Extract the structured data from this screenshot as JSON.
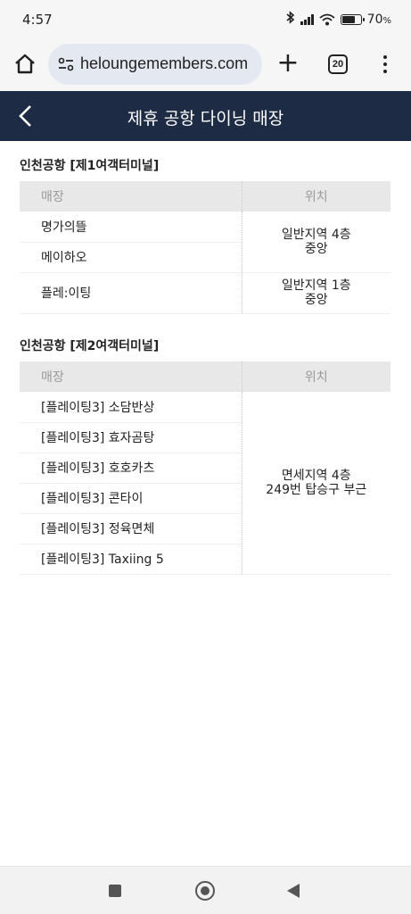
{
  "status_bar": {
    "time": "4:57",
    "battery_percent": "70",
    "battery_unit": "%",
    "battery_level": 0.7,
    "icons": [
      "bluetooth-icon",
      "signal-icon",
      "wifi-icon",
      "battery-icon"
    ]
  },
  "browser": {
    "url": "heloungemembers.com",
    "tab_count": "20",
    "icons": [
      "home-icon",
      "tune-icon",
      "plus-icon",
      "tabs-icon",
      "more-vert-icon"
    ]
  },
  "header": {
    "title": "제휴 공항 다이닝 매장",
    "background": "#1e2b45"
  },
  "sections": [
    {
      "title": "인천공항 [제1여객터미널]",
      "col_store": "매장",
      "col_location": "위치",
      "rows": [
        {
          "store": "명가의뜰",
          "location": [
            "일반지역 4층",
            "중앙"
          ]
        },
        {
          "store": "메이하오"
        },
        {
          "store": "플레:이팅",
          "location": [
            "일반지역 1층",
            "중앙"
          ]
        }
      ]
    },
    {
      "title": "인천공항 [제2여객터미널]",
      "col_store": "매장",
      "col_location": "위치",
      "rows": [
        {
          "store": "[플레이팅3] 소담반상",
          "location": [
            "면세지역 4층",
            "249번 탑승구 부근"
          ]
        },
        {
          "store": "[플레이팅3] 효자곰탕"
        },
        {
          "store": "[플레이팅3] 호호카츠"
        },
        {
          "store": "[플레이팅3] 콘타이"
        },
        {
          "store": "[플레이팅3] 정육면체"
        },
        {
          "store": "[플레이팅3] Taxiing 5"
        }
      ]
    }
  ],
  "nav_bar": {
    "icons": [
      "recents-icon",
      "home-circle-icon",
      "back-triangle-icon"
    ]
  }
}
